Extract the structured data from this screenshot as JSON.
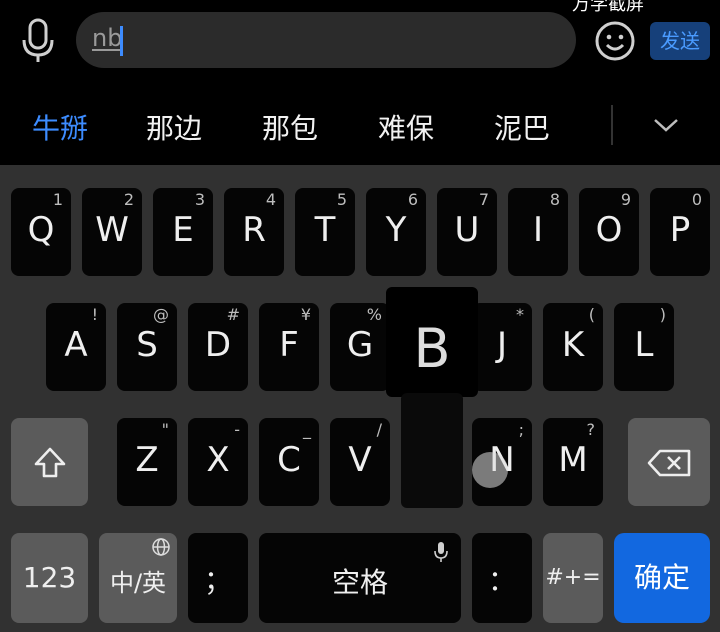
{
  "top": {
    "overlay_text": "万学截屏",
    "input_text": "nb",
    "send_label": "发送"
  },
  "candidates": [
    "牛掰",
    "那边",
    "那包",
    "难保",
    "泥巴"
  ],
  "keyboard": {
    "row1": [
      {
        "key": "Q",
        "sub": "1"
      },
      {
        "key": "W",
        "sub": "2"
      },
      {
        "key": "E",
        "sub": "3"
      },
      {
        "key": "R",
        "sub": "4"
      },
      {
        "key": "T",
        "sub": "5"
      },
      {
        "key": "Y",
        "sub": "6"
      },
      {
        "key": "U",
        "sub": "7"
      },
      {
        "key": "I",
        "sub": "8"
      },
      {
        "key": "O",
        "sub": "9"
      },
      {
        "key": "P",
        "sub": "0"
      }
    ],
    "row2": [
      {
        "key": "A",
        "sub": "!"
      },
      {
        "key": "S",
        "sub": "@"
      },
      {
        "key": "D",
        "sub": "#"
      },
      {
        "key": "F",
        "sub": "¥"
      },
      {
        "key": "G",
        "sub": "%"
      },
      {
        "key": "J",
        "sub": "*"
      },
      {
        "key": "K",
        "sub": "("
      },
      {
        "key": "L",
        "sub": ")"
      }
    ],
    "row3": [
      {
        "key": "Z",
        "sub": "\""
      },
      {
        "key": "X",
        "sub": "-"
      },
      {
        "key": "C",
        "sub": "_"
      },
      {
        "key": "V",
        "sub": "/"
      },
      {
        "key": "N",
        "sub": ";"
      },
      {
        "key": "M",
        "sub": "?"
      }
    ],
    "popup_key": "B",
    "num_label": "123",
    "lang_label": "中/英",
    "semicolon_label": "；",
    "space_label": "空格",
    "colon_label": "：",
    "symbols_label": "#+=",
    "enter_label": "确定"
  }
}
